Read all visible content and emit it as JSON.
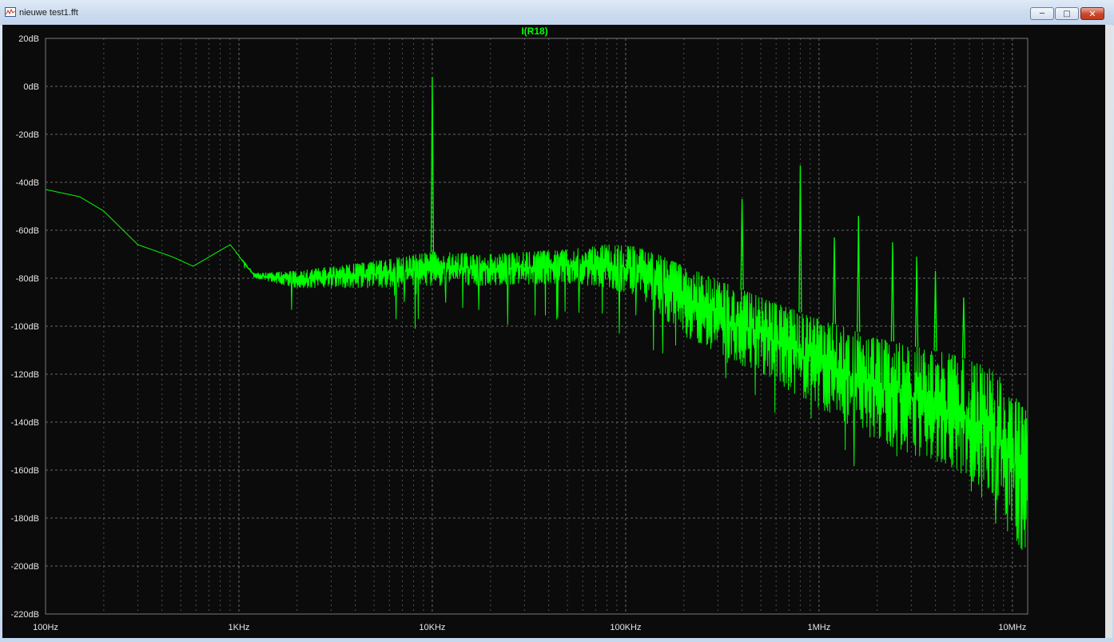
{
  "window": {
    "title": "nieuwe test1.fft",
    "app_icon": "waveform-viewer-icon",
    "buttons": {
      "minimize": "minimize-icon",
      "maximize": "maximize-icon",
      "close": "close-icon"
    }
  },
  "chart_data": {
    "type": "line",
    "title": "I(R18)",
    "xlabel": "",
    "ylabel": "",
    "xscale": "log",
    "xlim": [
      100,
      12000000
    ],
    "ylim": [
      -220,
      20
    ],
    "grid": true,
    "background": "#0b0b0b",
    "trace_color": "#00ff00",
    "x_ticks": [
      {
        "value": 100,
        "label": "100Hz"
      },
      {
        "value": 1000,
        "label": "1KHz"
      },
      {
        "value": 10000,
        "label": "10KHz"
      },
      {
        "value": 100000,
        "label": "100KHz"
      },
      {
        "value": 1000000,
        "label": "1MHz"
      },
      {
        "value": 10000000,
        "label": "10MHz"
      }
    ],
    "y_ticks": [
      {
        "value": 20,
        "label": "20dB"
      },
      {
        "value": 0,
        "label": "0dB"
      },
      {
        "value": -20,
        "label": "-20dB"
      },
      {
        "value": -40,
        "label": "-40dB"
      },
      {
        "value": -60,
        "label": "-60dB"
      },
      {
        "value": -80,
        "label": "-80dB"
      },
      {
        "value": -100,
        "label": "-100dB"
      },
      {
        "value": -120,
        "label": "-120dB"
      },
      {
        "value": -140,
        "label": "-140dB"
      },
      {
        "value": -160,
        "label": "-160dB"
      },
      {
        "value": -180,
        "label": "-180dB"
      },
      {
        "value": -200,
        "label": "-200dB"
      },
      {
        "value": -220,
        "label": "-220dB"
      }
    ],
    "series": [
      {
        "name": "I(R18)",
        "envelope": {
          "x": [
            100,
            150,
            200,
            300,
            450,
            580,
            900,
            1200,
            2000,
            5000,
            10000,
            20000,
            50000,
            80000,
            120000,
            200000,
            500000,
            1000000,
            2000000,
            5000000,
            8000000,
            12000000
          ],
          "upper": [
            -43,
            -46,
            -52,
            -66,
            -71,
            -75,
            -66,
            -78,
            -77,
            -73,
            -69,
            -70,
            -68,
            -66,
            -67,
            -75,
            -88,
            -97,
            -105,
            -112,
            -118,
            -136
          ],
          "lower": [
            -43,
            -46,
            -52,
            -66,
            -71,
            -75,
            -66,
            -80,
            -84,
            -84,
            -83,
            -83,
            -82,
            -84,
            -88,
            -104,
            -120,
            -134,
            -148,
            -160,
            -170,
            -200
          ]
        },
        "peaks": [
          {
            "x": 10000,
            "y": 4
          },
          {
            "x": 400000,
            "y": -47
          },
          {
            "x": 800000,
            "y": -33
          },
          {
            "x": 1600000,
            "y": -54
          },
          {
            "x": 1200000,
            "y": -63
          },
          {
            "x": 2400000,
            "y": -65
          },
          {
            "x": 3200000,
            "y": -71
          },
          {
            "x": 4000000,
            "y": -77
          },
          {
            "x": 5600000,
            "y": -88
          }
        ]
      }
    ]
  }
}
